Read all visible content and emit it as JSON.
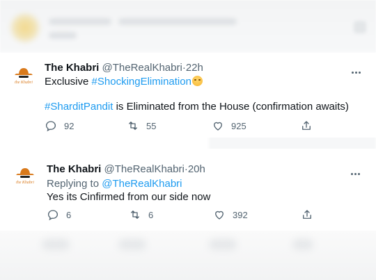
{
  "tweets": [
    {
      "name": "The Khabri",
      "handle": "@TheRealKhabri",
      "separator": "·",
      "time": "22h",
      "line1_text": "Exclusive ",
      "line1_hashtag": "#ShockingElimination",
      "line2_hashtag": "#SharditPandit",
      "line2_text": " is Eliminated from the House (confirmation awaits)",
      "replies": "92",
      "retweets": "55",
      "likes": "925"
    },
    {
      "name": "The Khabri",
      "handle": "@TheRealKhabri",
      "separator": "·",
      "time": "20h",
      "replying_prefix": "Replying to ",
      "replying_handle": "@TheRealKhabri",
      "line1_text": "Yes its Cinfirmed from our side now",
      "replies": "6",
      "retweets": "6",
      "likes": "392"
    }
  ],
  "avatar_text": "the Khabri",
  "icons": {
    "reply": "reply-icon",
    "retweet": "retweet-icon",
    "like": "like-icon",
    "share": "share-icon",
    "more": "more-icon"
  },
  "colors": {
    "link": "#1d9bf0",
    "muted": "#536471",
    "text": "#0f1419",
    "avatar_orange": "#d97a1c"
  }
}
